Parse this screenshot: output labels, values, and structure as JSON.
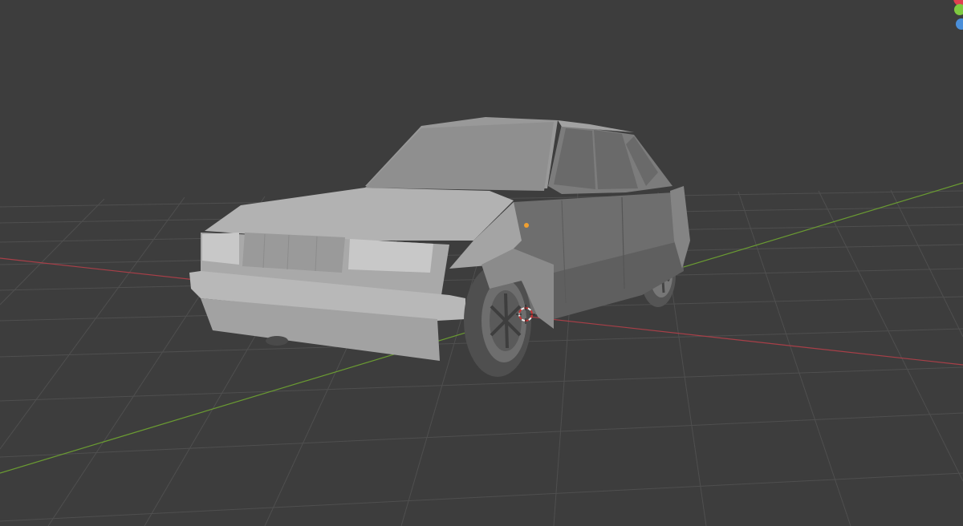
{
  "viewport": {
    "background_color": "#3d3d3d",
    "grid_color": "#555555",
    "x_axis_color": "#a83f48",
    "y_axis_color": "#6a9b32",
    "shading": "solid"
  },
  "object": {
    "kind": "low-poly hatchback car model",
    "base_color": "#9c9c9c",
    "origin_color": "#f0a030"
  },
  "cursor_3d": {
    "ring_color": "#cc3333"
  },
  "navigation_gizmo": {
    "axes": [
      {
        "icon": "x-axis-dot",
        "color": "#e04050"
      },
      {
        "icon": "y-axis-dot",
        "color": "#7ec940"
      },
      {
        "icon": "z-axis-dot",
        "color": "#4a8ed8"
      }
    ]
  }
}
